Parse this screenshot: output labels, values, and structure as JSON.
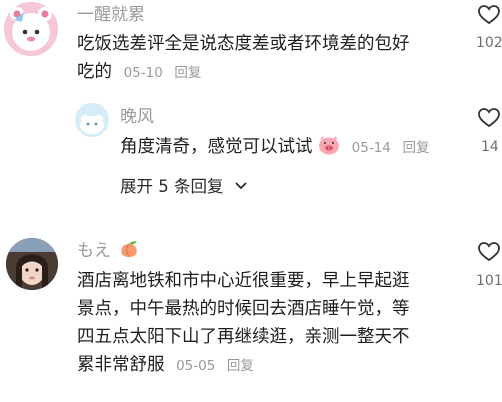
{
  "comments": [
    {
      "user": "一醒就累",
      "line1": "吃饭选差评全是说态度差或者环境差的包好",
      "line2": "吃的",
      "date": "05-10",
      "reply_label": "回复",
      "like_count": "102"
    },
    {
      "user": "晚风",
      "text": "角度清奇，感觉可以试试",
      "date": "05-14",
      "reply_label": "回复",
      "like_count": "14"
    },
    {
      "user": "もえ",
      "line1": "酒店离地铁和市中心近很重要，早上早起逛",
      "line2": "景点，中午最热的时候回去酒店睡午觉，等",
      "line3": "四五点太阳下山了再继续逛，亲测一整天不",
      "line4": "累非常舒服",
      "date": "05-05",
      "reply_label": "回复",
      "like_count": "101"
    }
  ],
  "expand_replies": "展开 5 条回复",
  "icons": {
    "like": "heart-outline-icon",
    "emoji_face": "pig-face-emoji-icon",
    "emoji_peach": "peach-emoji-icon",
    "expand": "chevron-down-icon"
  }
}
